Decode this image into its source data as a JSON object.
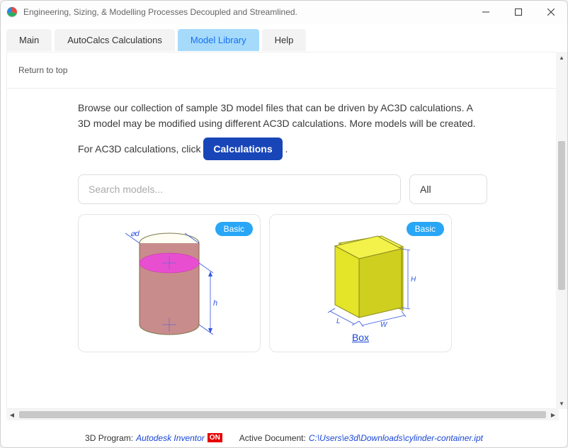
{
  "window": {
    "title": "Engineering, Sizing, & Modelling Processes Decoupled and Streamlined."
  },
  "tabs": [
    {
      "label": "Main"
    },
    {
      "label": "AutoCalcs Calculations"
    },
    {
      "label": "Model Library"
    },
    {
      "label": "Help"
    }
  ],
  "page": {
    "returnLabel": "Return to top",
    "description": "Browse our collection of sample 3D model files that can be driven by AC3D calculations. A 3D model may be modified using different AC3D calculations. More models will be created.",
    "calcPrefix": "For AC3D calculations, click ",
    "calcButton": "Calculations",
    "calcSuffix": ".",
    "searchPlaceholder": "Search models...",
    "filterValue": "All",
    "cards": [
      {
        "badge": "Basic",
        "title": ""
      },
      {
        "badge": "Basic",
        "title": "Box"
      }
    ]
  },
  "status": {
    "programLabel": "3D Program:",
    "programValue": "Autodesk Inventor",
    "programState": "ON",
    "docLabel": "Active Document:",
    "docValue": "C:\\Users\\e3d\\Downloads\\cylinder-container.ipt"
  }
}
